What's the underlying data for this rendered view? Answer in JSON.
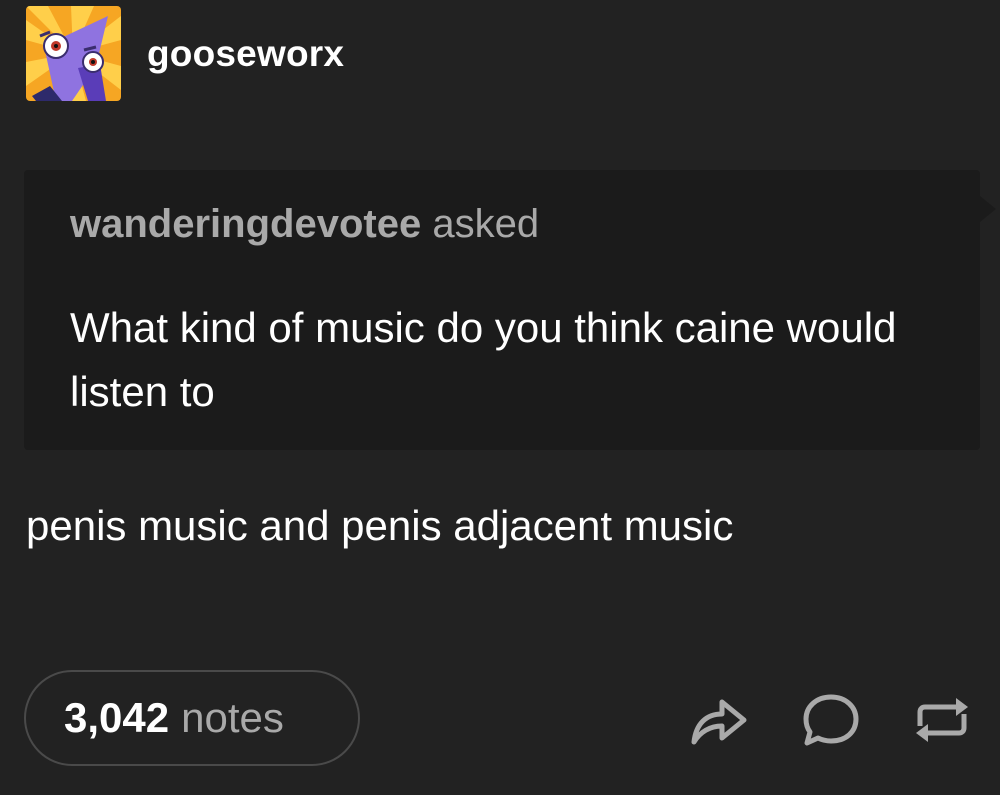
{
  "post": {
    "blog_name": "gooseworx",
    "avatar_icon": "purple-triangle-character-avatar",
    "ask": {
      "asker": "wanderingdevotee",
      "asked_label": "asked",
      "question": "What kind of music do you think caine would listen to"
    },
    "answer": "penis music and penis adjacent music",
    "notes": {
      "count": "3,042",
      "label": "notes"
    },
    "actions": {
      "share_icon": "share-arrow-icon",
      "reply_icon": "speech-bubble-icon",
      "reblog_icon": "reblog-arrows-icon"
    }
  },
  "colors": {
    "background": "#222222",
    "ask_background": "#1b1b1b",
    "muted_text": "#a9a9a9",
    "primary_text": "#ffffff",
    "pill_border": "#4a4a4a"
  }
}
